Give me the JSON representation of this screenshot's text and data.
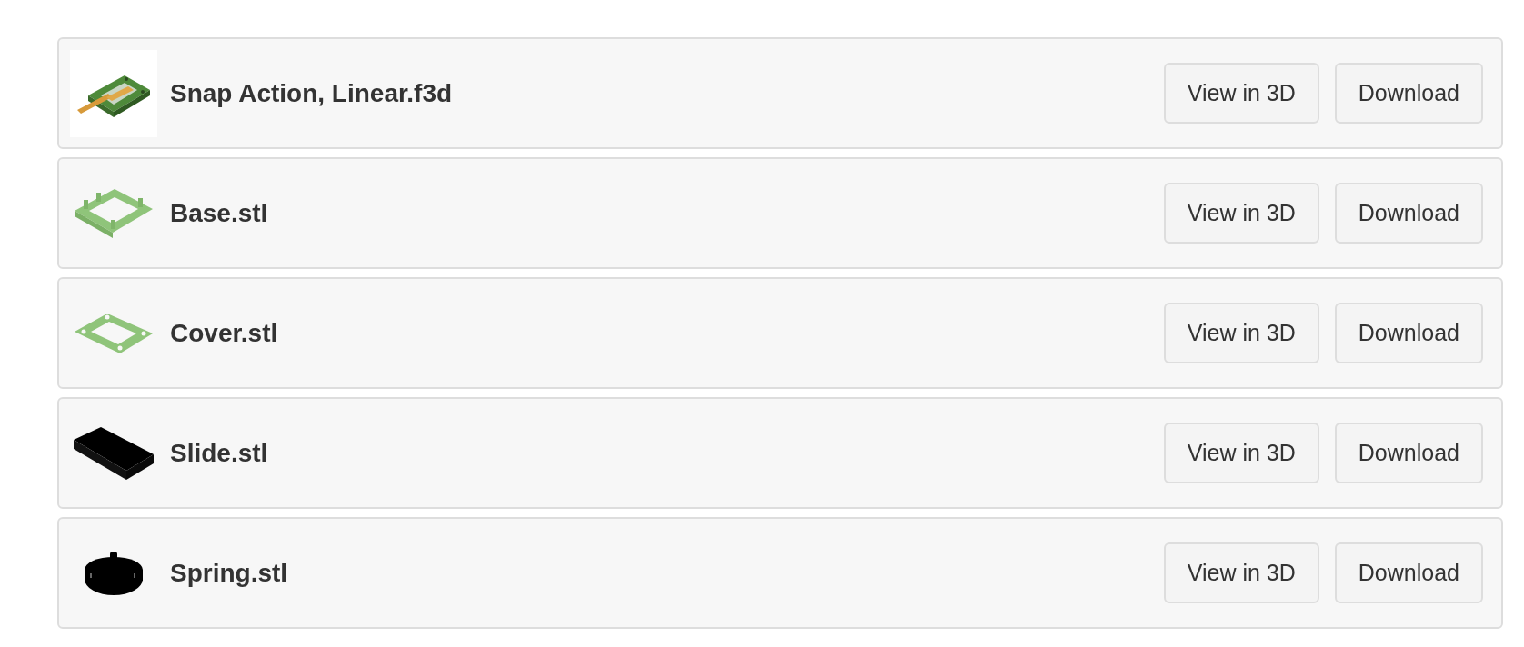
{
  "files": [
    {
      "name": "Snap Action, Linear.f3d",
      "buttons": [
        "View in 3D",
        "Download"
      ]
    },
    {
      "name": "Base.stl",
      "buttons": [
        "View in 3D",
        "Download"
      ]
    },
    {
      "name": "Cover.stl",
      "buttons": [
        "View in 3D",
        "Download"
      ]
    },
    {
      "name": "Slide.stl",
      "buttons": [
        "View in 3D",
        "Download"
      ]
    },
    {
      "name": "Spring.stl",
      "buttons": [
        "View in 3D",
        "Download"
      ]
    }
  ]
}
